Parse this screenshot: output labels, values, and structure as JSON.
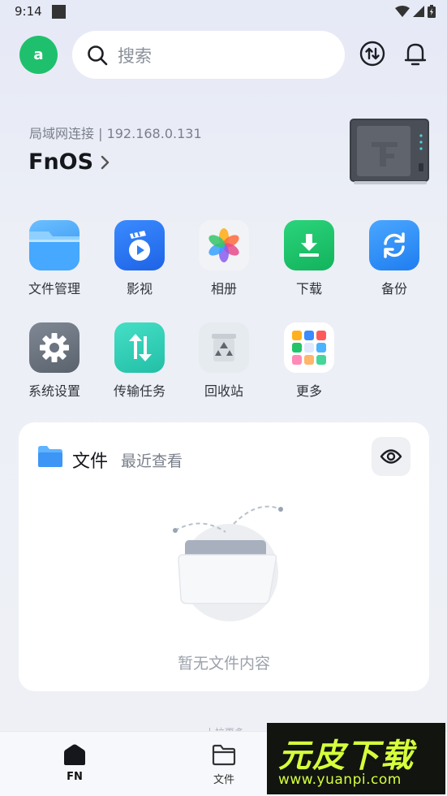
{
  "status_bar": {
    "time": "9:14"
  },
  "header": {
    "avatar_letter": "a",
    "search_placeholder": "搜索"
  },
  "connection": {
    "label": "局域网连接 | 192.168.0.131",
    "device_name": "FnOS"
  },
  "apps": [
    {
      "label": "文件管理",
      "icon": "folder-icon",
      "color": "#4aa6ff"
    },
    {
      "label": "影视",
      "icon": "video-icon",
      "color": "#2f7ff5"
    },
    {
      "label": "相册",
      "icon": "photos-icon",
      "color": "#f2f3f6"
    },
    {
      "label": "下载",
      "icon": "download-icon",
      "color": "#1ec46a"
    },
    {
      "label": "备份",
      "icon": "sync-icon",
      "color": "#2f8ef5"
    },
    {
      "label": "系统设置",
      "icon": "gear-icon",
      "color": "#6b7480"
    },
    {
      "label": "传输任务",
      "icon": "transfer-icon",
      "color": "#2fcfb8"
    },
    {
      "label": "回收站",
      "icon": "recycle-icon",
      "color": "#e6ebef"
    },
    {
      "label": "更多",
      "icon": "more-apps-icon",
      "color": "#ffffff"
    }
  ],
  "files_card": {
    "title": "文件",
    "subtitle": "最近查看",
    "empty_text": "暂无文件内容"
  },
  "more_hint": "· · · 上拉更多",
  "bottom_nav": [
    {
      "label": "FN",
      "icon": "home-icon",
      "active": true
    },
    {
      "label": "文件",
      "icon": "folder-outline-icon",
      "active": false
    }
  ],
  "watermark": {
    "title": "元皮下载",
    "url": "www.yuanpi.com"
  }
}
